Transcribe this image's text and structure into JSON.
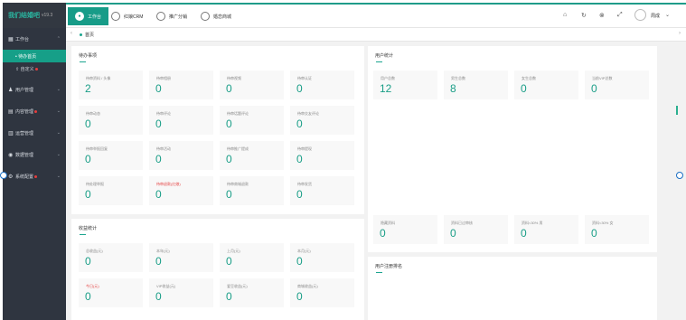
{
  "app": {
    "logo": "我们结婚吧",
    "version": "v19.3"
  },
  "sidebar": {
    "items": [
      {
        "label": "工作台",
        "icon": "grid-icon",
        "expanded": true,
        "badge": false
      },
      {
        "label": "用户管理",
        "icon": "user-icon",
        "badge": false
      },
      {
        "label": "内容管理",
        "icon": "content-icon",
        "badge": true
      },
      {
        "label": "运营管理",
        "icon": "chart-icon",
        "badge": false
      },
      {
        "label": "数据管理",
        "icon": "database-icon",
        "badge": false
      },
      {
        "label": "系统配置",
        "icon": "gear-icon",
        "badge": true
      }
    ],
    "sub_items": [
      {
        "label": "• 待办首页",
        "active": true
      },
      {
        "label": "⇧ 自定义",
        "badge": true
      }
    ]
  },
  "topbar": {
    "tabs": [
      {
        "label": "工作台",
        "active": true
      },
      {
        "label": "红娘CRM"
      },
      {
        "label": "推广分销"
      },
      {
        "label": "婚恋商城"
      }
    ],
    "username": "周成"
  },
  "breadcrumb": {
    "current": "首页"
  },
  "todo_card": {
    "title": "待办事项",
    "stats": [
      {
        "label": "待审资料 / 头像",
        "value": "2"
      },
      {
        "label": "待审相册",
        "value": "0"
      },
      {
        "label": "待审视频",
        "value": "0"
      },
      {
        "label": "待审认证",
        "value": "0"
      },
      {
        "label": "待审动态",
        "value": "0"
      },
      {
        "label": "待审评论",
        "value": "0"
      },
      {
        "label": "待审话题评论",
        "value": "0"
      },
      {
        "label": "待审交友评论",
        "value": "0"
      },
      {
        "label": "待审举报回复",
        "value": "0"
      },
      {
        "label": "待审活动",
        "value": "0"
      },
      {
        "label": "待审推广提成",
        "value": "0"
      },
      {
        "label": "待审提现",
        "value": "0"
      },
      {
        "label": "待处理举报",
        "value": "0"
      },
      {
        "label": "待审退款(红娘)",
        "value": "0",
        "red": true
      },
      {
        "label": "待审商城退款",
        "value": "0"
      },
      {
        "label": "待审发货",
        "value": "0"
      }
    ]
  },
  "income_card": {
    "title": "收益统计",
    "stats": [
      {
        "label": "总收益(元)",
        "value": "0"
      },
      {
        "label": "本年(元)",
        "value": "0"
      },
      {
        "label": "上月(元)",
        "value": "0"
      },
      {
        "label": "本月(元)",
        "value": "0"
      },
      {
        "label": "今日(元)",
        "value": "0",
        "red": true
      },
      {
        "label": "VIP收益(元)",
        "value": "0"
      },
      {
        "label": "爱豆收益(元)",
        "value": "0"
      },
      {
        "label": "商城收益(元)",
        "value": "0"
      }
    ]
  },
  "user_card": {
    "title": "用户统计",
    "stats": [
      {
        "label": "用户总数",
        "value": "12"
      },
      {
        "label": "男生总数",
        "value": "8"
      },
      {
        "label": "女生总数",
        "value": "0"
      },
      {
        "label": "当前VIP总数",
        "value": "0"
      }
    ],
    "bottom_stats": [
      {
        "label": "隐藏资料",
        "value": "0"
      },
      {
        "label": "资料已过审核",
        "value": "0"
      },
      {
        "label": "资料<30% 男",
        "value": "0"
      },
      {
        "label": "资料<30% 女",
        "value": "0"
      }
    ]
  },
  "register_card": {
    "title": "用户注册排名"
  }
}
